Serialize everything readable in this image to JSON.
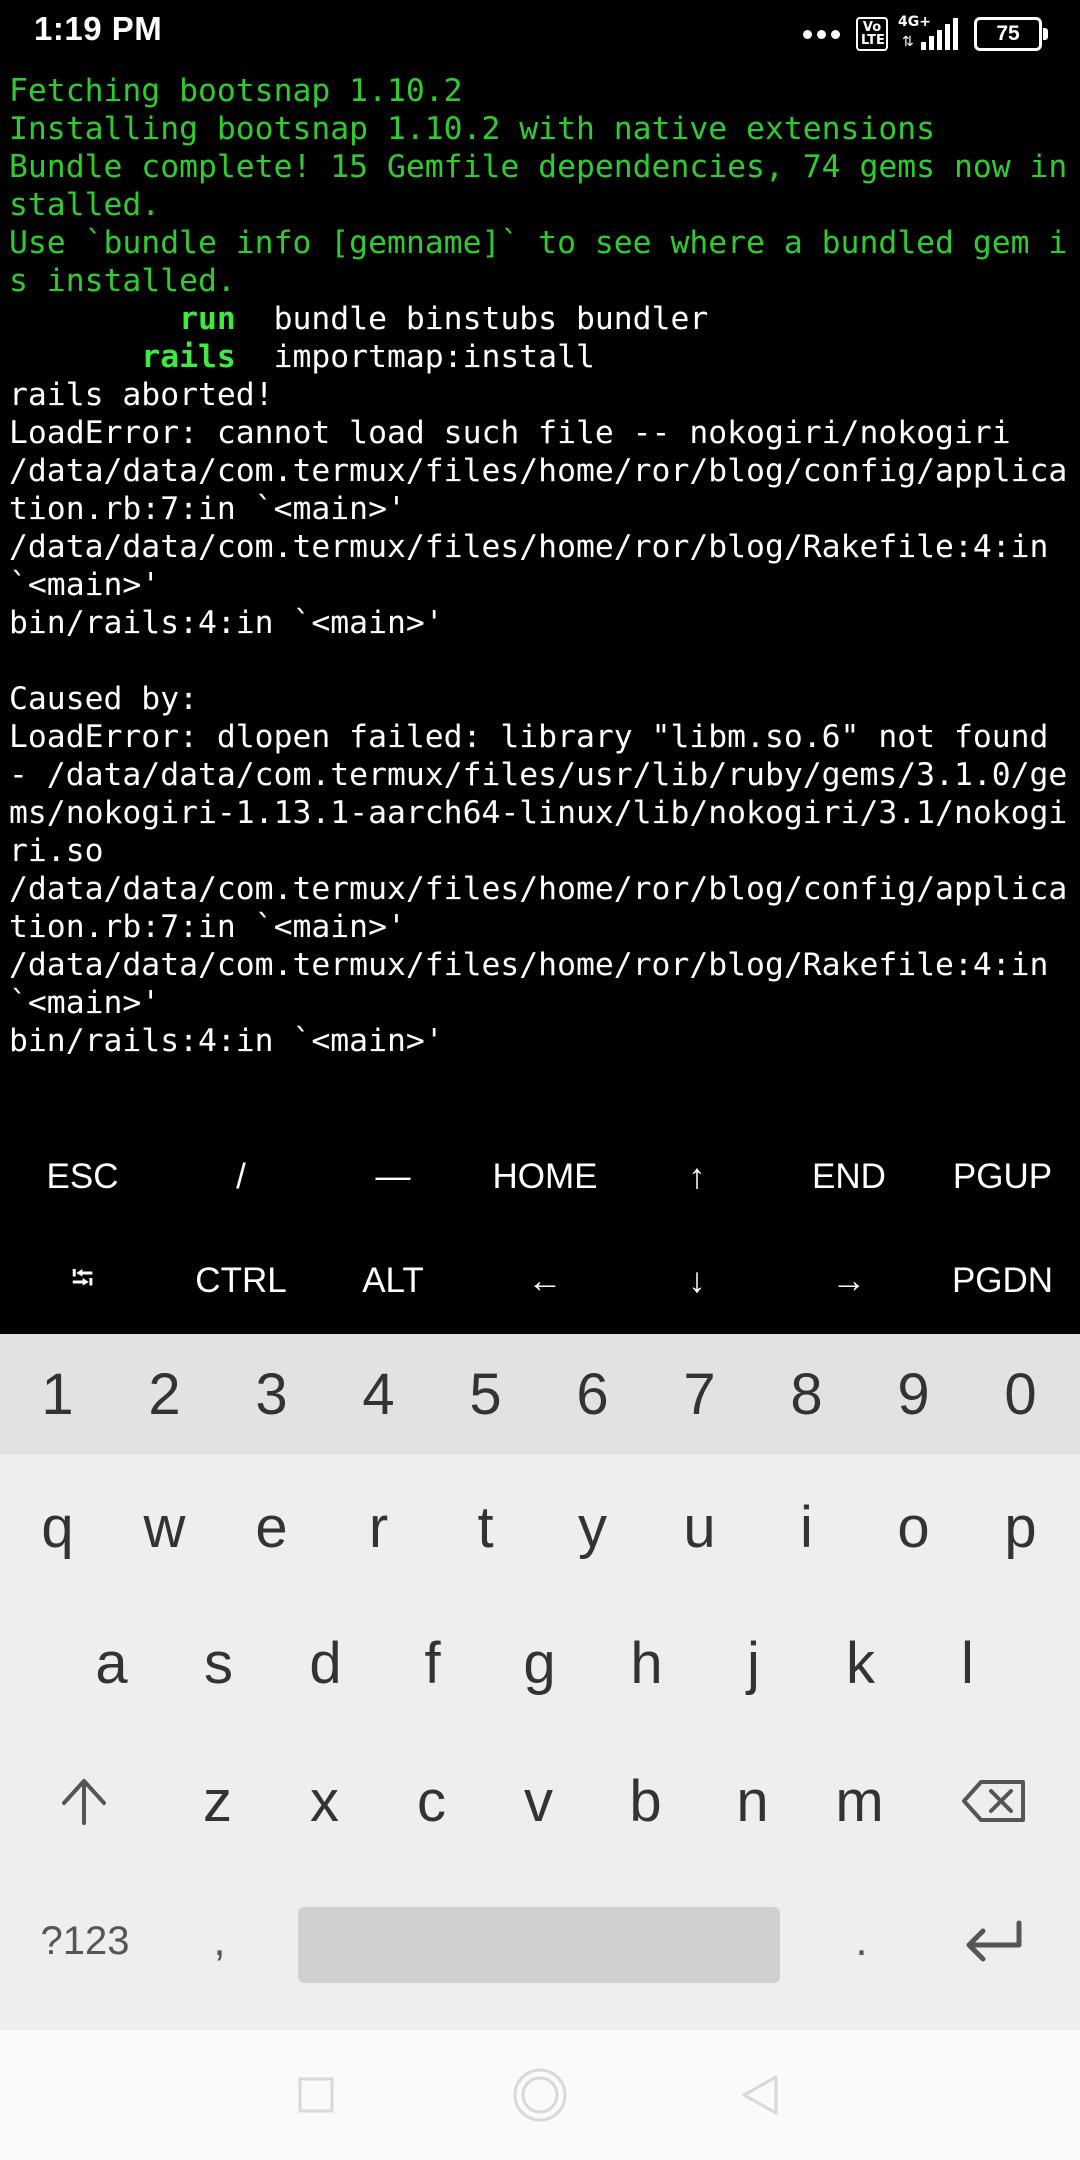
{
  "status_bar": {
    "time": "1:19 PM",
    "volte": "Vo\nLTE",
    "network": "4G+",
    "battery": "75"
  },
  "terminal": {
    "lines": [
      {
        "text": "Fetching bootsnap 1.10.2",
        "color": "green"
      },
      {
        "text": "Installing bootsnap 1.10.2 with native extensions",
        "color": "green"
      },
      {
        "text": "Bundle complete! 15 Gemfile dependencies, 74 gems now in",
        "color": "green"
      },
      {
        "text": "stalled.",
        "color": "green"
      },
      {
        "text": "Use `bundle info [gemname]` to see where a bundled gem i",
        "color": "green"
      },
      {
        "text": "s installed.",
        "color": "green"
      },
      {
        "prefix": "         run",
        "text": "  bundle binstubs bundler",
        "color": "white"
      },
      {
        "prefix": "       rails",
        "text": "  importmap:install",
        "color": "white"
      },
      {
        "text": "rails aborted!",
        "color": "white"
      },
      {
        "text": "LoadError: cannot load such file -- nokogiri/nokogiri",
        "color": "white"
      },
      {
        "text": "/data/data/com.termux/files/home/ror/blog/config/applica",
        "color": "white"
      },
      {
        "text": "tion.rb:7:in `<main>'",
        "color": "white"
      },
      {
        "text": "/data/data/com.termux/files/home/ror/blog/Rakefile:4:in",
        "color": "white"
      },
      {
        "text": "`<main>'",
        "color": "white"
      },
      {
        "text": "bin/rails:4:in `<main>'",
        "color": "white"
      },
      {
        "text": "",
        "color": "white"
      },
      {
        "text": "Caused by:",
        "color": "white"
      },
      {
        "text": "LoadError: dlopen failed: library \"libm.so.6\" not found",
        "color": "white"
      },
      {
        "text": "- /data/data/com.termux/files/usr/lib/ruby/gems/3.1.0/ge",
        "color": "white"
      },
      {
        "text": "ms/nokogiri-1.13.1-aarch64-linux/lib/nokogiri/3.1/nokogi",
        "color": "white"
      },
      {
        "text": "ri.so",
        "color": "white"
      },
      {
        "text": "/data/data/com.termux/files/home/ror/blog/config/applica",
        "color": "white"
      },
      {
        "text": "tion.rb:7:in `<main>'",
        "color": "white"
      },
      {
        "text": "/data/data/com.termux/files/home/ror/blog/Rakefile:4:in",
        "color": "white"
      },
      {
        "text": "`<main>'",
        "color": "white"
      },
      {
        "text": "bin/rails:4:in `<main>'",
        "color": "white"
      }
    ]
  },
  "extra_keys": {
    "row1": [
      "ESC",
      "/",
      "—",
      "HOME",
      "↑",
      "END",
      "PGUP"
    ],
    "row2": [
      "⭾",
      "CTRL",
      "ALT",
      "←",
      "↓",
      "→",
      "PGDN"
    ]
  },
  "keyboard": {
    "numbers": [
      "1",
      "2",
      "3",
      "4",
      "5",
      "6",
      "7",
      "8",
      "9",
      "0"
    ],
    "row1": [
      "q",
      "w",
      "e",
      "r",
      "t",
      "y",
      "u",
      "i",
      "o",
      "p"
    ],
    "row2": [
      "a",
      "s",
      "d",
      "f",
      "g",
      "h",
      "j",
      "k",
      "l"
    ],
    "row3": [
      "z",
      "x",
      "c",
      "v",
      "b",
      "n",
      "m"
    ],
    "symbols_label": "?123",
    "comma": ",",
    "period": "."
  },
  "colors": {
    "terminal_green": "#2fcc2f",
    "keyboard_bg": "#eeeeee",
    "number_row_bg": "#e2e2e2"
  }
}
